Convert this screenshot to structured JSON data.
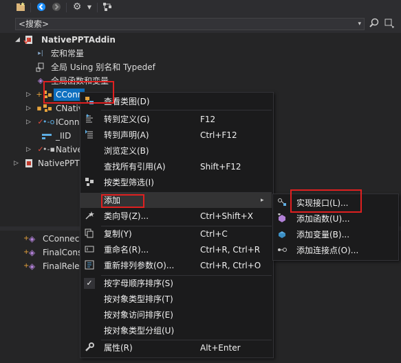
{
  "toolbar": {
    "icons": [
      "new-folder-icon",
      "back-icon",
      "forward-icon",
      "settings-icon",
      "dropdown-arrow-icon",
      "sync-icon"
    ]
  },
  "search": {
    "value": "<搜索>",
    "dropdown_glyph": "▾"
  },
  "tree": {
    "project": "NativePPTAddin",
    "items": [
      {
        "label": "宏和常量",
        "icon": "macro-icon"
      },
      {
        "label": "全局 Using 别名和 Typedef",
        "icon": "typedef-icon"
      },
      {
        "label": "全局函数和变量",
        "icon": "global-functions-icon"
      },
      {
        "label": "CConn",
        "icon": "class-icon",
        "selected": true
      },
      {
        "label": "CNativ",
        "icon": "class-icon"
      },
      {
        "label": "IConn",
        "icon": "interface-icon"
      },
      {
        "label": "_IID",
        "icon": "struct-icon"
      },
      {
        "label": "Native",
        "icon": "interface-icon"
      }
    ],
    "second_project": "NativePPT"
  },
  "members": [
    {
      "label": "CConnec",
      "icon": "method-icon"
    },
    {
      "label": "FinalCons",
      "icon": "method-icon"
    },
    {
      "label": "FinalRele",
      "icon": "method-icon"
    }
  ],
  "context_menu": {
    "items": [
      {
        "label": "查看类图(D)",
        "shortcut": "",
        "icon": "class-diagram-icon"
      },
      {
        "label": "转到定义(G)",
        "shortcut": "F12",
        "icon": "goto-definition-icon"
      },
      {
        "label": "转到声明(A)",
        "shortcut": "Ctrl+F12",
        "icon": "goto-declaration-icon"
      },
      {
        "label": "浏览定义(B)",
        "shortcut": "",
        "icon": ""
      },
      {
        "label": "查找所有引用(A)",
        "shortcut": "Shift+F12",
        "icon": ""
      },
      {
        "label": "按类型筛选(I)",
        "shortcut": "",
        "icon": "filter-type-icon"
      },
      {
        "label": "添加",
        "shortcut": "",
        "icon": "",
        "submenu": true
      },
      {
        "label": "类向导(Z)...",
        "shortcut": "Ctrl+Shift+X",
        "icon": "class-wizard-icon"
      },
      {
        "label": "复制(Y)",
        "shortcut": "Ctrl+C",
        "icon": "copy-icon"
      },
      {
        "label": "重命名(R)...",
        "shortcut": "Ctrl+R, Ctrl+R",
        "icon": "rename-icon"
      },
      {
        "label": "重新排列参数(O)...",
        "shortcut": "Ctrl+R, Ctrl+O",
        "icon": "reorder-icon"
      },
      {
        "label": "按字母顺序排序(S)",
        "shortcut": "",
        "icon": "check-icon"
      },
      {
        "label": "按对象类型排序(T)",
        "shortcut": "",
        "icon": ""
      },
      {
        "label": "按对象访问排序(E)",
        "shortcut": "",
        "icon": ""
      },
      {
        "label": "按对象类型分组(U)",
        "shortcut": "",
        "icon": ""
      },
      {
        "label": "属性(R)",
        "shortcut": "Alt+Enter",
        "icon": "wrench-icon"
      }
    ],
    "submenu_arrow": "▸"
  },
  "submenu": {
    "items": [
      {
        "label": "实现接口(L)...",
        "icon": "implement-interface-icon"
      },
      {
        "label": "添加函数(U)...",
        "icon": "add-function-icon"
      },
      {
        "label": "添加变量(B)...",
        "icon": "add-variable-icon"
      },
      {
        "label": "添加连接点(O)...",
        "icon": "add-connection-point-icon"
      }
    ]
  },
  "colors": {
    "background": "#252526",
    "menu_bg": "#1b1b1c",
    "highlight_box": "#e02020",
    "selection": "#0e70c0"
  }
}
